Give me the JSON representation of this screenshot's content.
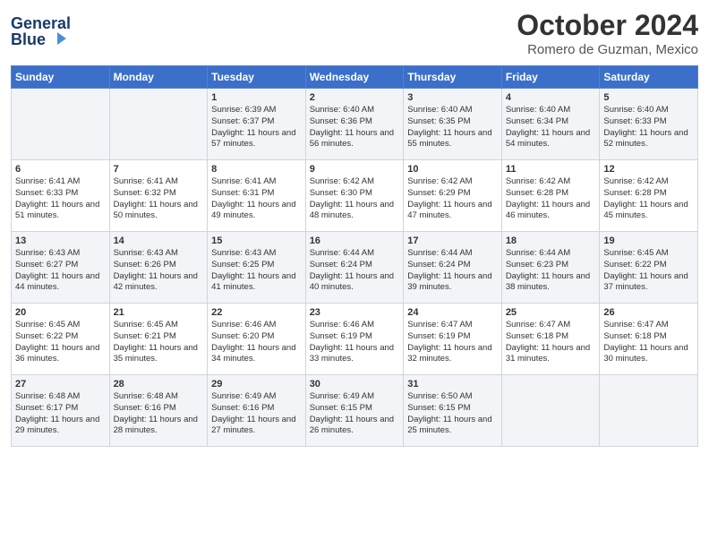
{
  "header": {
    "logo_line1": "General",
    "logo_line2": "Blue",
    "month": "October 2024",
    "location": "Romero de Guzman, Mexico"
  },
  "days_of_week": [
    "Sunday",
    "Monday",
    "Tuesday",
    "Wednesday",
    "Thursday",
    "Friday",
    "Saturday"
  ],
  "weeks": [
    [
      {
        "day": "",
        "sunrise": "",
        "sunset": "",
        "daylight": ""
      },
      {
        "day": "",
        "sunrise": "",
        "sunset": "",
        "daylight": ""
      },
      {
        "day": "1",
        "sunrise": "Sunrise: 6:39 AM",
        "sunset": "Sunset: 6:37 PM",
        "daylight": "Daylight: 11 hours and 57 minutes."
      },
      {
        "day": "2",
        "sunrise": "Sunrise: 6:40 AM",
        "sunset": "Sunset: 6:36 PM",
        "daylight": "Daylight: 11 hours and 56 minutes."
      },
      {
        "day": "3",
        "sunrise": "Sunrise: 6:40 AM",
        "sunset": "Sunset: 6:35 PM",
        "daylight": "Daylight: 11 hours and 55 minutes."
      },
      {
        "day": "4",
        "sunrise": "Sunrise: 6:40 AM",
        "sunset": "Sunset: 6:34 PM",
        "daylight": "Daylight: 11 hours and 54 minutes."
      },
      {
        "day": "5",
        "sunrise": "Sunrise: 6:40 AM",
        "sunset": "Sunset: 6:33 PM",
        "daylight": "Daylight: 11 hours and 52 minutes."
      }
    ],
    [
      {
        "day": "6",
        "sunrise": "Sunrise: 6:41 AM",
        "sunset": "Sunset: 6:33 PM",
        "daylight": "Daylight: 11 hours and 51 minutes."
      },
      {
        "day": "7",
        "sunrise": "Sunrise: 6:41 AM",
        "sunset": "Sunset: 6:32 PM",
        "daylight": "Daylight: 11 hours and 50 minutes."
      },
      {
        "day": "8",
        "sunrise": "Sunrise: 6:41 AM",
        "sunset": "Sunset: 6:31 PM",
        "daylight": "Daylight: 11 hours and 49 minutes."
      },
      {
        "day": "9",
        "sunrise": "Sunrise: 6:42 AM",
        "sunset": "Sunset: 6:30 PM",
        "daylight": "Daylight: 11 hours and 48 minutes."
      },
      {
        "day": "10",
        "sunrise": "Sunrise: 6:42 AM",
        "sunset": "Sunset: 6:29 PM",
        "daylight": "Daylight: 11 hours and 47 minutes."
      },
      {
        "day": "11",
        "sunrise": "Sunrise: 6:42 AM",
        "sunset": "Sunset: 6:28 PM",
        "daylight": "Daylight: 11 hours and 46 minutes."
      },
      {
        "day": "12",
        "sunrise": "Sunrise: 6:42 AM",
        "sunset": "Sunset: 6:28 PM",
        "daylight": "Daylight: 11 hours and 45 minutes."
      }
    ],
    [
      {
        "day": "13",
        "sunrise": "Sunrise: 6:43 AM",
        "sunset": "Sunset: 6:27 PM",
        "daylight": "Daylight: 11 hours and 44 minutes."
      },
      {
        "day": "14",
        "sunrise": "Sunrise: 6:43 AM",
        "sunset": "Sunset: 6:26 PM",
        "daylight": "Daylight: 11 hours and 42 minutes."
      },
      {
        "day": "15",
        "sunrise": "Sunrise: 6:43 AM",
        "sunset": "Sunset: 6:25 PM",
        "daylight": "Daylight: 11 hours and 41 minutes."
      },
      {
        "day": "16",
        "sunrise": "Sunrise: 6:44 AM",
        "sunset": "Sunset: 6:24 PM",
        "daylight": "Daylight: 11 hours and 40 minutes."
      },
      {
        "day": "17",
        "sunrise": "Sunrise: 6:44 AM",
        "sunset": "Sunset: 6:24 PM",
        "daylight": "Daylight: 11 hours and 39 minutes."
      },
      {
        "day": "18",
        "sunrise": "Sunrise: 6:44 AM",
        "sunset": "Sunset: 6:23 PM",
        "daylight": "Daylight: 11 hours and 38 minutes."
      },
      {
        "day": "19",
        "sunrise": "Sunrise: 6:45 AM",
        "sunset": "Sunset: 6:22 PM",
        "daylight": "Daylight: 11 hours and 37 minutes."
      }
    ],
    [
      {
        "day": "20",
        "sunrise": "Sunrise: 6:45 AM",
        "sunset": "Sunset: 6:22 PM",
        "daylight": "Daylight: 11 hours and 36 minutes."
      },
      {
        "day": "21",
        "sunrise": "Sunrise: 6:45 AM",
        "sunset": "Sunset: 6:21 PM",
        "daylight": "Daylight: 11 hours and 35 minutes."
      },
      {
        "day": "22",
        "sunrise": "Sunrise: 6:46 AM",
        "sunset": "Sunset: 6:20 PM",
        "daylight": "Daylight: 11 hours and 34 minutes."
      },
      {
        "day": "23",
        "sunrise": "Sunrise: 6:46 AM",
        "sunset": "Sunset: 6:19 PM",
        "daylight": "Daylight: 11 hours and 33 minutes."
      },
      {
        "day": "24",
        "sunrise": "Sunrise: 6:47 AM",
        "sunset": "Sunset: 6:19 PM",
        "daylight": "Daylight: 11 hours and 32 minutes."
      },
      {
        "day": "25",
        "sunrise": "Sunrise: 6:47 AM",
        "sunset": "Sunset: 6:18 PM",
        "daylight": "Daylight: 11 hours and 31 minutes."
      },
      {
        "day": "26",
        "sunrise": "Sunrise: 6:47 AM",
        "sunset": "Sunset: 6:18 PM",
        "daylight": "Daylight: 11 hours and 30 minutes."
      }
    ],
    [
      {
        "day": "27",
        "sunrise": "Sunrise: 6:48 AM",
        "sunset": "Sunset: 6:17 PM",
        "daylight": "Daylight: 11 hours and 29 minutes."
      },
      {
        "day": "28",
        "sunrise": "Sunrise: 6:48 AM",
        "sunset": "Sunset: 6:16 PM",
        "daylight": "Daylight: 11 hours and 28 minutes."
      },
      {
        "day": "29",
        "sunrise": "Sunrise: 6:49 AM",
        "sunset": "Sunset: 6:16 PM",
        "daylight": "Daylight: 11 hours and 27 minutes."
      },
      {
        "day": "30",
        "sunrise": "Sunrise: 6:49 AM",
        "sunset": "Sunset: 6:15 PM",
        "daylight": "Daylight: 11 hours and 26 minutes."
      },
      {
        "day": "31",
        "sunrise": "Sunrise: 6:50 AM",
        "sunset": "Sunset: 6:15 PM",
        "daylight": "Daylight: 11 hours and 25 minutes."
      },
      {
        "day": "",
        "sunrise": "",
        "sunset": "",
        "daylight": ""
      },
      {
        "day": "",
        "sunrise": "",
        "sunset": "",
        "daylight": ""
      }
    ]
  ]
}
